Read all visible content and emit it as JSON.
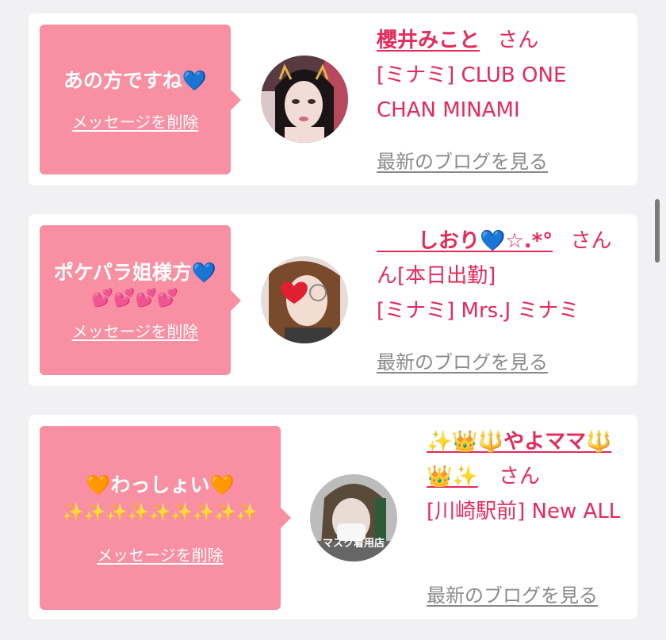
{
  "accent_color": "#e7285b",
  "bubble_color": "#f98fa2",
  "cards": [
    {
      "message": "あの方ですね💙",
      "delete_label": "メッセージを削除",
      "name": "櫻井みこと",
      "san": "さん",
      "shop": "[ミナミ] CLUB ONE CHAN MINAMI",
      "blog_label": "最新のブログを見る"
    },
    {
      "message": "ポケパラ姐様方💙",
      "message_line2": "💕💕💕💕",
      "delete_label": "メッセージを削除",
      "name_prefix": "　　",
      "name": "しおり💙☆.*°",
      "san": "さん",
      "shop_line1": "ん[本日出勤]",
      "shop_line2": "[ミナミ] Mrs.J ミナミ",
      "blog_label": "最新のブログを見る"
    },
    {
      "message": "🧡わっしょい🧡",
      "message_line2": "✨✨✨✨✨✨✨✨✨",
      "delete_label": "メッセージを削除",
      "name": "✨👑🔱やよママ🔱👑✨",
      "san": "さん",
      "shop": "[川崎駅前] New ALL",
      "avatar_caption": "マスク着用店",
      "blog_label": "最新のブログを見る"
    }
  ]
}
